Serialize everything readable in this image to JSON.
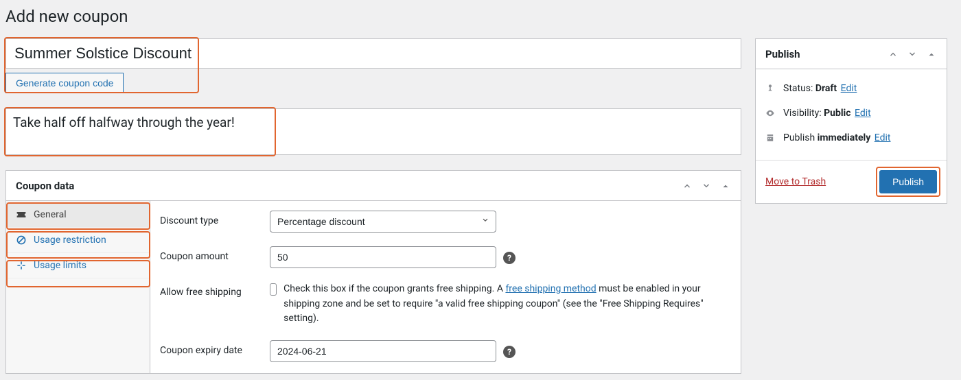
{
  "page_title": "Add new coupon",
  "coupon": {
    "title_value": "Summer Solstice Discount",
    "generate_label": "Generate coupon code",
    "description_value": "Take half off halfway through the year!"
  },
  "coupon_data": {
    "panel_title": "Coupon data",
    "tabs": [
      {
        "label": "General"
      },
      {
        "label": "Usage restriction"
      },
      {
        "label": "Usage limits"
      }
    ],
    "fields": {
      "discount_type_label": "Discount type",
      "discount_type_value": "Percentage discount",
      "coupon_amount_label": "Coupon amount",
      "coupon_amount_value": "50",
      "free_shipping_label": "Allow free shipping",
      "free_shipping_text_before": "Check this box if the coupon grants free shipping. A ",
      "free_shipping_link": "free shipping method",
      "free_shipping_text_after": " must be enabled in your shipping zone and be set to require \"a valid free shipping coupon\" (see the \"Free Shipping Requires\" setting).",
      "expiry_label": "Coupon expiry date",
      "expiry_value": "2024-06-21"
    }
  },
  "publish": {
    "panel_title": "Publish",
    "status_label": "Status: ",
    "status_value": "Draft",
    "visibility_label": "Visibility: ",
    "visibility_value": "Public",
    "publish_label": "Publish ",
    "publish_value": "immediately",
    "edit_label": "Edit",
    "trash_label": "Move to Trash",
    "button_label": "Publish"
  },
  "help_glyph": "?"
}
